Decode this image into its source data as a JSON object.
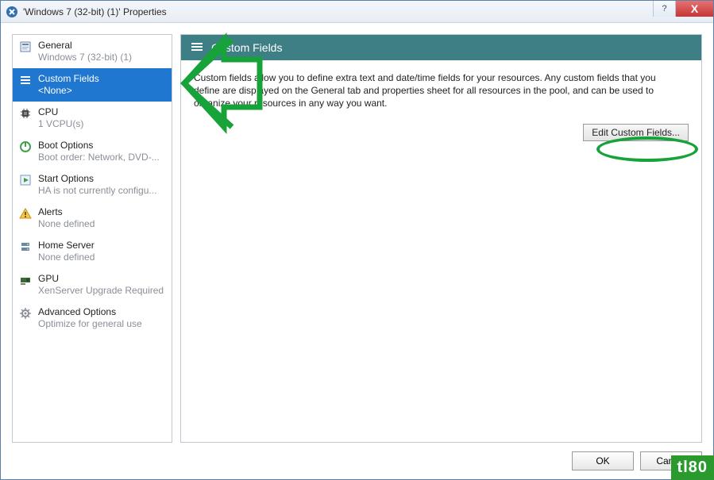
{
  "window": {
    "title": "'Windows 7 (32-bit) (1)' Properties",
    "help_symbol": "?",
    "close_symbol": "X"
  },
  "sidebar": {
    "items": [
      {
        "label": "General",
        "sub": "Windows 7 (32-bit) (1)",
        "icon": "properties-icon"
      },
      {
        "label": "Custom Fields",
        "sub": "<None>",
        "icon": "list-icon",
        "selected": true
      },
      {
        "label": "CPU",
        "sub": "1 VCPU(s)",
        "icon": "cpu-icon"
      },
      {
        "label": "Boot Options",
        "sub": "Boot order: Network, DVD-...",
        "icon": "power-icon"
      },
      {
        "label": "Start Options",
        "sub": "HA is not currently configu...",
        "icon": "start-icon"
      },
      {
        "label": "Alerts",
        "sub": "None defined",
        "icon": "alert-icon"
      },
      {
        "label": "Home Server",
        "sub": "None defined",
        "icon": "server-icon"
      },
      {
        "label": "GPU",
        "sub": "XenServer Upgrade Required",
        "icon": "gpu-icon"
      },
      {
        "label": "Advanced Options",
        "sub": "Optimize for general use",
        "icon": "gear-icon"
      }
    ]
  },
  "main": {
    "header_icon": "list-icon",
    "header_title": "Custom Fields",
    "description": "Custom fields allow you to define extra text and date/time fields for your resources. Any custom fields that you define are displayed on the General tab and properties sheet for all resources in the pool, and can be used to organize your resources in any way you want.",
    "edit_button": "Edit Custom Fields..."
  },
  "footer": {
    "ok": "OK",
    "cancel": "Cancel"
  },
  "watermark": "tl80",
  "annotation": {
    "arrow_color": "#17a23a"
  }
}
